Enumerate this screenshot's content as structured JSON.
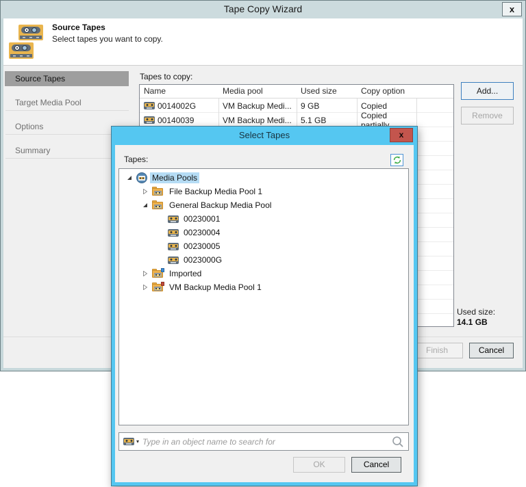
{
  "wizard": {
    "title": "Tape Copy Wizard",
    "close": "x",
    "banner": {
      "title": "Source Tapes",
      "subtitle": "Select tapes you want to copy."
    },
    "sidebar": [
      "Source Tapes",
      "Target Media Pool",
      "Options",
      "Summary"
    ],
    "tapes_to_copy_label": "Tapes to copy:",
    "table": {
      "columns": [
        "Name",
        "Media pool",
        "Used size",
        "Copy option"
      ],
      "rows": [
        {
          "name": "0014002G",
          "media_pool": "VM Backup Medi...",
          "used_size": "9 GB",
          "copy_option": "Copied"
        },
        {
          "name": "00140039",
          "media_pool": "VM Backup Medi...",
          "used_size": "5.1 GB",
          "copy_option": "Copied partially"
        }
      ]
    },
    "buttons": {
      "add": "Add...",
      "remove": "Remove",
      "finish": "Finish",
      "cancel": "Cancel"
    },
    "used_size": {
      "label": "Used size:",
      "value": "14.1 GB"
    }
  },
  "dialog": {
    "title": "Select Tapes",
    "close": "x",
    "tapes_label": "Tapes:",
    "tree": [
      {
        "label": "Media Pools",
        "level": 0,
        "state": "expanded",
        "icon": "media-pools-root",
        "selected": true
      },
      {
        "label": "File Backup Media Pool 1",
        "level": 1,
        "state": "collapsed",
        "icon": "media-pool-folder"
      },
      {
        "label": "General Backup Media Pool",
        "level": 1,
        "state": "expanded",
        "icon": "media-pool-folder"
      },
      {
        "label": "00230001",
        "level": 2,
        "state": "leaf",
        "icon": "tape"
      },
      {
        "label": "00230004",
        "level": 2,
        "state": "leaf",
        "icon": "tape"
      },
      {
        "label": "00230005",
        "level": 2,
        "state": "leaf",
        "icon": "tape"
      },
      {
        "label": "0023000G",
        "level": 2,
        "state": "leaf",
        "icon": "tape"
      },
      {
        "label": "Imported",
        "level": 1,
        "state": "collapsed",
        "icon": "imported-media-pool-folder"
      },
      {
        "label": "VM Backup Media Pool 1",
        "level": 1,
        "state": "collapsed",
        "icon": "vm-media-pool-folder"
      }
    ],
    "search_placeholder": "Type in an object name to search for",
    "buttons": {
      "ok": "OK",
      "cancel": "Cancel"
    }
  },
  "colors": {
    "dialog_accent": "#55c7f1",
    "dialog_close_red": "#c3554d",
    "selection_blue": "#b5dcf4",
    "wizard_titlebar": "#ccdbde",
    "nav_selected_gray": "#9e9e9e",
    "add_button_border": "#3c7fbf"
  }
}
